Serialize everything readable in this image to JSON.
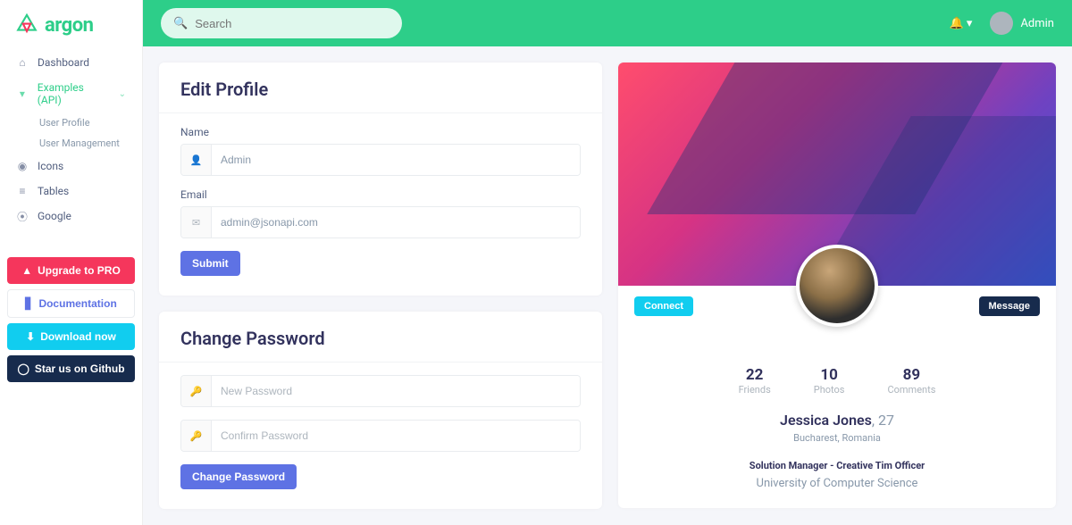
{
  "brand": "argon",
  "topbar": {
    "search_placeholder": "Search",
    "user": "Admin"
  },
  "sidebar": {
    "items": [
      {
        "icon": "home",
        "label": "Dashboard"
      },
      {
        "icon": "ex",
        "label": "Examples (API)",
        "active": true,
        "expanded": true,
        "children": [
          "User Profile",
          "User Management"
        ]
      },
      {
        "icon": "map",
        "label": "Icons"
      },
      {
        "icon": "list",
        "label": "Tables"
      },
      {
        "icon": "pin",
        "label": "Google"
      }
    ],
    "buttons": {
      "upgrade": "Upgrade to PRO",
      "docs": "Documentation",
      "download": "Download now",
      "star": "Star us on Github"
    }
  },
  "edit": {
    "title": "Edit Profile",
    "name_label": "Name",
    "name_value": "Admin",
    "email_label": "Email",
    "email_value": "admin@jsonapi.com",
    "submit": "Submit"
  },
  "pwd": {
    "title": "Change Password",
    "new_ph": "New Password",
    "confirm_ph": "Confirm Password",
    "submit": "Change Password"
  },
  "profile": {
    "connect": "Connect",
    "message": "Message",
    "stats": [
      {
        "n": "22",
        "l": "Friends"
      },
      {
        "n": "10",
        "l": "Photos"
      },
      {
        "n": "89",
        "l": "Comments"
      }
    ],
    "name": "Jessica Jones",
    "age": ", 27",
    "location": "Bucharest, Romania",
    "role": "Solution Manager - Creative Tim Officer",
    "edu": "University of Computer Science"
  }
}
